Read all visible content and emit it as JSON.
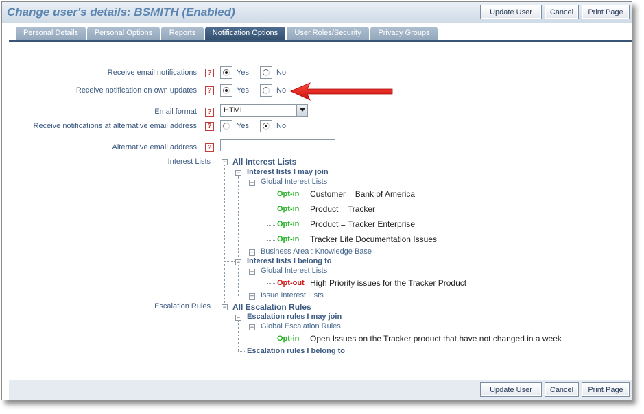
{
  "title": "Change user's details: BSMITH (Enabled)",
  "buttons": {
    "update": "Update User",
    "cancel": "Cancel",
    "print": "Print Page"
  },
  "tabs": [
    {
      "label": "Personal Details",
      "active": false
    },
    {
      "label": "Personal Options",
      "active": false
    },
    {
      "label": "Reports",
      "active": false
    },
    {
      "label": "Notification Options",
      "active": true
    },
    {
      "label": "User Roles/Security",
      "active": false
    },
    {
      "label": "Privacy Groups",
      "active": false
    }
  ],
  "help_glyph": "?",
  "yes": "Yes",
  "no": "No",
  "form": {
    "email_notifications": {
      "label": "Receive email notifications",
      "value": "Yes"
    },
    "own_updates": {
      "label": "Receive notification on own updates",
      "value": "Yes"
    },
    "email_format": {
      "label": "Email format",
      "value": "HTML"
    },
    "alt_notifications": {
      "label": "Receive notifications at alternative email address",
      "value": "No"
    },
    "alt_email": {
      "label": "Alternative email address",
      "value": ""
    }
  },
  "interest": {
    "label": "Interest Lists",
    "root": "All Interest Lists",
    "may_join": "Interest lists I may join",
    "global": "Global Interest Lists",
    "items_join": [
      {
        "status": "Opt-in",
        "name": "Customer = Bank of America"
      },
      {
        "status": "Opt-in",
        "name": "Product = Tracker"
      },
      {
        "status": "Opt-in",
        "name": "Product = Tracker Enterprise"
      },
      {
        "status": "Opt-in",
        "name": "Tracker Lite Documentation Issues"
      }
    ],
    "business_area": "Business Area : Knowledge Base",
    "belong_to": "Interest lists I belong to",
    "global2": "Global Interest Lists",
    "items_belong": [
      {
        "status": "Opt-out",
        "name": "High Priority issues for the Tracker Product"
      }
    ],
    "issue_lists": "Issue Interest Lists"
  },
  "escalation": {
    "label": "Escalation Rules",
    "root": "All Escalation Rules",
    "may_join": "Escalation rules I may join",
    "global": "Global Escalation Rules",
    "items_join": [
      {
        "status": "Opt-in",
        "name": "Open Issues on the Tracker product that have not changed in a week"
      }
    ],
    "belong_to": "Escalation rules I belong to"
  },
  "colors": {
    "accent": "#3a5677",
    "optin": "#22b322",
    "optout": "#d01818",
    "arrow": "#e01b1b"
  },
  "icons": {
    "help": "help-icon",
    "expand": "plus-box-icon",
    "collapse": "minus-box-icon",
    "annotation": "red-arrow-icon"
  }
}
